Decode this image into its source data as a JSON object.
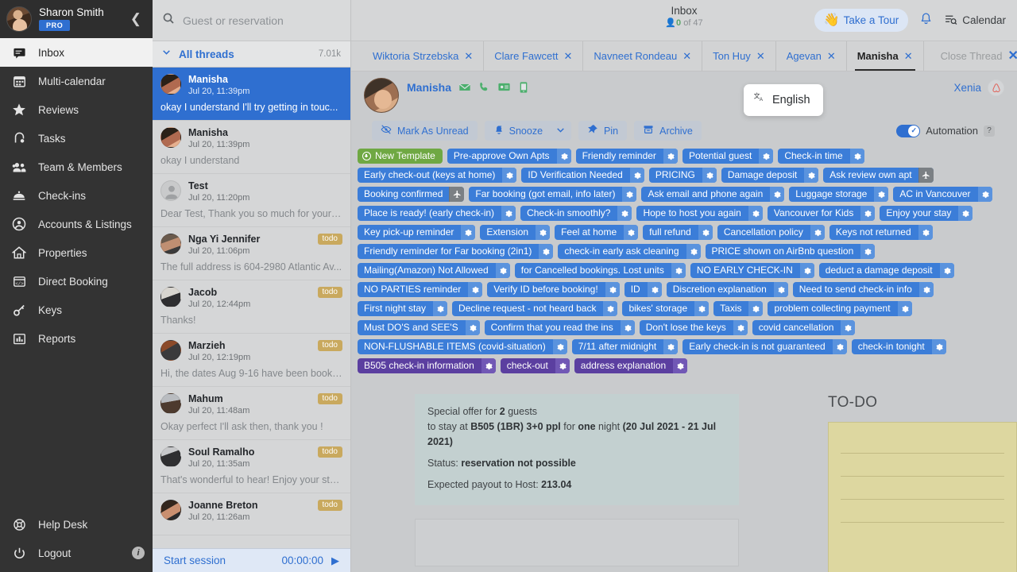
{
  "sidebar": {
    "user": {
      "name": "Sharon Smith",
      "plan": "PRO"
    },
    "collapse_icon": "chevron-left-icon",
    "items": [
      {
        "label": "Inbox",
        "icon": "chat-icon",
        "active": true
      },
      {
        "label": "Multi-calendar",
        "icon": "calendar-icon",
        "active": false
      },
      {
        "label": "Reviews",
        "icon": "star-icon",
        "active": false
      },
      {
        "label": "Tasks",
        "icon": "tasks-icon",
        "active": false
      },
      {
        "label": "Team & Members",
        "icon": "people-icon",
        "active": false
      },
      {
        "label": "Check-ins",
        "icon": "bell-desk-icon",
        "active": false
      },
      {
        "label": "Accounts & Listings",
        "icon": "account-circle-icon",
        "active": false
      },
      {
        "label": "Properties",
        "icon": "home-icon",
        "active": false
      },
      {
        "label": "Direct Booking",
        "icon": "code-window-icon",
        "active": false
      },
      {
        "label": "Keys",
        "icon": "key-icon",
        "active": false
      },
      {
        "label": "Reports",
        "icon": "bar-chart-icon",
        "active": false
      }
    ],
    "bottom": [
      {
        "label": "Help Desk",
        "icon": "lifebuoy-icon"
      },
      {
        "label": "Logout",
        "icon": "power-icon"
      }
    ],
    "info_badge": "i"
  },
  "threads": {
    "search_placeholder": "Guest or reservation",
    "search_value": "",
    "filter_label": "All threads",
    "filter_count": "7.01k",
    "items": [
      {
        "name": "Manisha",
        "time": "Jul 20, 11:39pm",
        "snippet": "okay I understand I'll try getting in touc...",
        "badge": "",
        "selected": true
      },
      {
        "name": "Manisha",
        "time": "Jul 20, 11:39pm",
        "snippet": "okay I understand",
        "badge": "",
        "selected": false
      },
      {
        "name": "Test",
        "time": "Jul 20, 11:20pm",
        "snippet": "Dear Test, Thank you so much for your b...",
        "badge": "",
        "selected": false
      },
      {
        "name": "Nga Yi Jennifer",
        "time": "Jul 20, 11:06pm",
        "snippet": "The full address is 604-2980 Atlantic Av...",
        "badge": "todo",
        "selected": false
      },
      {
        "name": "Jacob",
        "time": "Jul 20, 12:44pm",
        "snippet": "Thanks!",
        "badge": "todo",
        "selected": false
      },
      {
        "name": "Marzieh",
        "time": "Jul 20, 12:19pm",
        "snippet": "Hi, the dates Aug 9-16 have been booke...",
        "badge": "todo",
        "selected": false
      },
      {
        "name": "Mahum",
        "time": "Jul 20, 11:48am",
        "snippet": "Okay perfect I'll ask then, thank you !",
        "badge": "todo",
        "selected": false
      },
      {
        "name": "Soul Ramalho",
        "time": "Jul 20, 11:35am",
        "snippet": "That's wonderful to hear! Enjoy your sta...",
        "badge": "todo",
        "selected": false
      },
      {
        "name": "Joanne Breton",
        "time": "Jul 20, 11:26am",
        "snippet": "",
        "badge": "todo",
        "selected": false
      }
    ],
    "session": {
      "label": "Start session",
      "timer": "00:00:00",
      "play_icon": "play-icon"
    }
  },
  "topbar": {
    "title": "Inbox",
    "subtitle_count": "0",
    "subtitle_rest": " of 47",
    "tour_label": "Take a Tour",
    "tour_emoji": "👋",
    "bell_icon": "bell-icon",
    "calendar_label": "Calendar"
  },
  "tabs": [
    {
      "label": "Wiktoria Strzebska",
      "active": false
    },
    {
      "label": "Clare Fawcett",
      "active": false
    },
    {
      "label": "Navneet Rondeau",
      "active": false
    },
    {
      "label": "Ton Huy",
      "active": false
    },
    {
      "label": "Agevan",
      "active": false
    },
    {
      "label": "Manisha",
      "active": true
    }
  ],
  "close_thread": {
    "label": "Close Thread",
    "x": "✕"
  },
  "conversation": {
    "guest_name": "Manisha",
    "channel_icons": [
      "airbnb-message-icon",
      "phone-icon",
      "id-card-icon",
      "mobile-icon"
    ],
    "account_label": "Xenia",
    "account_badge_icon": "airbnb-icon",
    "language_popup": {
      "icon": "translate-icon",
      "label": "English"
    },
    "actions": [
      {
        "label": "Mark As Unread",
        "icon": "eye-slash-icon"
      },
      {
        "label": "Snooze",
        "icon": "snooze-bell-icon",
        "caret": "chevron-down-icon"
      },
      {
        "label": "Pin",
        "icon": "pin-icon"
      },
      {
        "label": "Archive",
        "icon": "archive-icon"
      }
    ],
    "automation": {
      "label": "Automation",
      "enabled": true,
      "help": "?"
    }
  },
  "templates": [
    {
      "label": "New Template",
      "style": "new"
    },
    {
      "label": "Pre-approve Own Apts",
      "style": "blue"
    },
    {
      "label": "Friendly reminder",
      "style": "blue"
    },
    {
      "label": "Potential guest",
      "style": "blue"
    },
    {
      "label": "Check-in time",
      "style": "blue"
    },
    {
      "label": "Early check-out (keys at home)",
      "style": "blue"
    },
    {
      "label": "ID Verification Needed",
      "style": "blue"
    },
    {
      "label": "PRICING",
      "style": "blue"
    },
    {
      "label": "Damage deposit",
      "style": "blue"
    },
    {
      "label": "Ask review own apt",
      "style": "blue-plane"
    },
    {
      "label": "Booking confirmed",
      "style": "blue-plane"
    },
    {
      "label": "Far booking (got email, info later)",
      "style": "blue"
    },
    {
      "label": "Ask email and phone again",
      "style": "blue"
    },
    {
      "label": "Luggage storage",
      "style": "blue"
    },
    {
      "label": "AC in Vancouver",
      "style": "blue"
    },
    {
      "label": "Place is ready! (early check-in)",
      "style": "blue"
    },
    {
      "label": "Check-in smoothly?",
      "style": "blue"
    },
    {
      "label": "Hope to host you again",
      "style": "blue"
    },
    {
      "label": "Vancouver for Kids",
      "style": "blue"
    },
    {
      "label": "Enjoy your stay",
      "style": "blue"
    },
    {
      "label": "Key pick-up reminder",
      "style": "blue"
    },
    {
      "label": "Extension",
      "style": "blue"
    },
    {
      "label": "Feel at home",
      "style": "blue"
    },
    {
      "label": "full refund",
      "style": "blue"
    },
    {
      "label": "Cancellation policy",
      "style": "blue"
    },
    {
      "label": "Keys not returned",
      "style": "blue"
    },
    {
      "label": "Friendly reminder for Far booking (2in1)",
      "style": "blue"
    },
    {
      "label": "check-in early ask cleaning",
      "style": "blue"
    },
    {
      "label": "PRICE shown on AirBnb question",
      "style": "blue"
    },
    {
      "label": "Mailing(Amazon) Not Allowed",
      "style": "blue"
    },
    {
      "label": "for Cancelled bookings. Lost units",
      "style": "blue"
    },
    {
      "label": "NO EARLY CHECK-IN",
      "style": "blue"
    },
    {
      "label": "deduct a damage deposit",
      "style": "blue"
    },
    {
      "label": "NO PARTIES reminder",
      "style": "blue"
    },
    {
      "label": "Verify ID before booking!",
      "style": "blue"
    },
    {
      "label": "ID",
      "style": "blue"
    },
    {
      "label": "Discretion explanation",
      "style": "blue"
    },
    {
      "label": "Need to send check-in info",
      "style": "blue"
    },
    {
      "label": "First night stay",
      "style": "blue"
    },
    {
      "label": "Decline request - not heard back",
      "style": "blue"
    },
    {
      "label": "bikes' storage",
      "style": "blue"
    },
    {
      "label": "Taxis",
      "style": "blue"
    },
    {
      "label": "problem collecting payment",
      "style": "blue"
    },
    {
      "label": "Must DO'S and SEE'S",
      "style": "blue"
    },
    {
      "label": "Confirm that you read the ins",
      "style": "blue"
    },
    {
      "label": "Don't lose the keys",
      "style": "blue"
    },
    {
      "label": "covid cancellation",
      "style": "blue"
    },
    {
      "label": "NON-FLUSHABLE ITEMS (covid-situation)",
      "style": "blue"
    },
    {
      "label": "7/11 after midnight",
      "style": "blue"
    },
    {
      "label": "Early check-in is not guaranteed",
      "style": "blue"
    },
    {
      "label": "check-in tonight",
      "style": "blue"
    },
    {
      "label": "B505 check-in information",
      "style": "purple"
    },
    {
      "label": "check-out",
      "style": "purple"
    },
    {
      "label": "address explanation",
      "style": "purple"
    }
  ],
  "offer": {
    "line1_pre": "Special offer for ",
    "line1_bold": "2",
    "line1_post": " guests",
    "line2_pre": "to stay at ",
    "line2_b1": "B505 (1BR) 3+0 ppl",
    "line2_mid": " for ",
    "line2_b2": "one",
    "line2_mid2": " night ",
    "line2_b3": "(20 Jul 2021 - 21 Jul 2021)",
    "status_label": "Status: ",
    "status_value": "reservation not possible",
    "payout_label": "Expected payout to Host: ",
    "payout_value": "213.04"
  },
  "todo": {
    "title": "TO-DO",
    "note_lines": 4
  }
}
